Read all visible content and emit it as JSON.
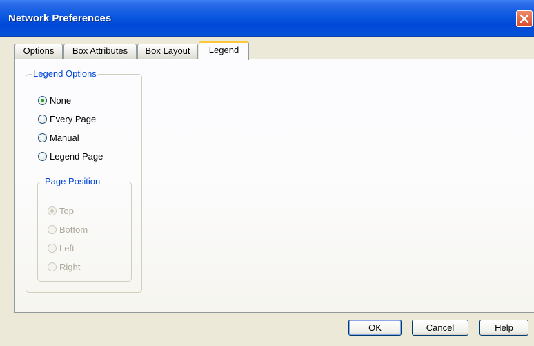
{
  "window": {
    "title": "Network Preferences",
    "close_icon": "close-icon"
  },
  "tabs": [
    {
      "label": "Options",
      "active": false
    },
    {
      "label": "Box Attributes",
      "active": false
    },
    {
      "label": "Box Layout",
      "active": false
    },
    {
      "label": "Legend",
      "active": true
    }
  ],
  "legend_options": {
    "title": "Legend Options",
    "selected": "None",
    "options": [
      "None",
      "Every Page",
      "Manual",
      "Legend Page"
    ]
  },
  "page_position": {
    "title": "Page Position",
    "enabled": false,
    "selected": "Top",
    "options": [
      "Top",
      "Bottom",
      "Left",
      "Right"
    ]
  },
  "buttons": {
    "ok": "OK",
    "cancel": "Cancel",
    "help": "Help"
  },
  "colors": {
    "titlebar": "#0054e3",
    "group_title": "#0046d5",
    "radio_dot": "#21a121",
    "active_tab_highlight": "#ffc83c"
  }
}
